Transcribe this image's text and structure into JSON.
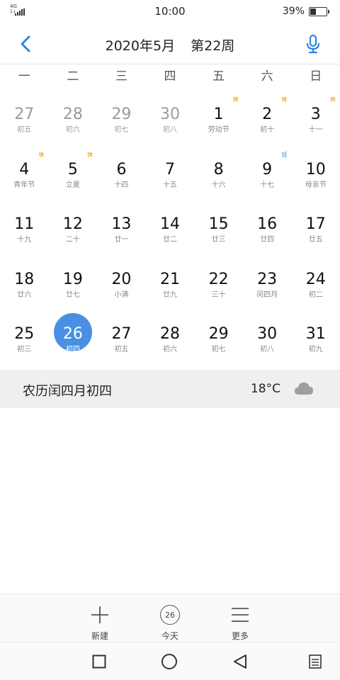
{
  "status_bar": {
    "network": "4G",
    "network_sub": "1↓",
    "time": "10:00",
    "battery_percent": "39%",
    "battery_level": 0.39
  },
  "header": {
    "title_month": "2020年5月",
    "title_week": "第22周"
  },
  "weekdays": [
    "一",
    "二",
    "三",
    "四",
    "五",
    "六",
    "日"
  ],
  "weeks": [
    [
      {
        "day": "27",
        "lunar": "初五",
        "other": true
      },
      {
        "day": "28",
        "lunar": "初六",
        "other": true
      },
      {
        "day": "29",
        "lunar": "初七",
        "other": true
      },
      {
        "day": "30",
        "lunar": "初八",
        "other": true
      },
      {
        "day": "1",
        "lunar": "劳动节",
        "badge": "休",
        "badge_type": "rest"
      },
      {
        "day": "2",
        "lunar": "初十",
        "badge": "休",
        "badge_type": "rest"
      },
      {
        "day": "3",
        "lunar": "十一",
        "badge": "休",
        "badge_type": "rest"
      }
    ],
    [
      {
        "day": "4",
        "lunar": "青年节",
        "badge": "休",
        "badge_type": "rest"
      },
      {
        "day": "5",
        "lunar": "立夏",
        "badge": "休",
        "badge_type": "rest"
      },
      {
        "day": "6",
        "lunar": "十四"
      },
      {
        "day": "7",
        "lunar": "十五"
      },
      {
        "day": "8",
        "lunar": "十六"
      },
      {
        "day": "9",
        "lunar": "十七",
        "badge": "班",
        "badge_type": "work"
      },
      {
        "day": "10",
        "lunar": "母亲节"
      }
    ],
    [
      {
        "day": "11",
        "lunar": "十九"
      },
      {
        "day": "12",
        "lunar": "二十"
      },
      {
        "day": "13",
        "lunar": "廿一"
      },
      {
        "day": "14",
        "lunar": "廿二"
      },
      {
        "day": "15",
        "lunar": "廿三"
      },
      {
        "day": "16",
        "lunar": "廿四"
      },
      {
        "day": "17",
        "lunar": "廿五"
      }
    ],
    [
      {
        "day": "18",
        "lunar": "廿六"
      },
      {
        "day": "19",
        "lunar": "廿七"
      },
      {
        "day": "20",
        "lunar": "小满"
      },
      {
        "day": "21",
        "lunar": "廿九"
      },
      {
        "day": "22",
        "lunar": "三十"
      },
      {
        "day": "23",
        "lunar": "闰四月"
      },
      {
        "day": "24",
        "lunar": "初二"
      }
    ],
    [
      {
        "day": "25",
        "lunar": "初三"
      },
      {
        "day": "26",
        "lunar": "初四",
        "selected": true
      },
      {
        "day": "27",
        "lunar": "初五"
      },
      {
        "day": "28",
        "lunar": "初六"
      },
      {
        "day": "29",
        "lunar": "初七"
      },
      {
        "day": "30",
        "lunar": "初八"
      },
      {
        "day": "31",
        "lunar": "初九"
      }
    ]
  ],
  "info": {
    "lunar_date": "农历闰四月初四",
    "temperature": "18°C",
    "weather_icon": "cloud-icon"
  },
  "toolbar": {
    "new_label": "新建",
    "today_label": "今天",
    "today_day": "26",
    "more_label": "更多"
  },
  "colors": {
    "accent": "#4a90e2",
    "rest_badge": "#f08c00",
    "work_badge": "#3a8ee6",
    "info_bg": "#efefef"
  }
}
